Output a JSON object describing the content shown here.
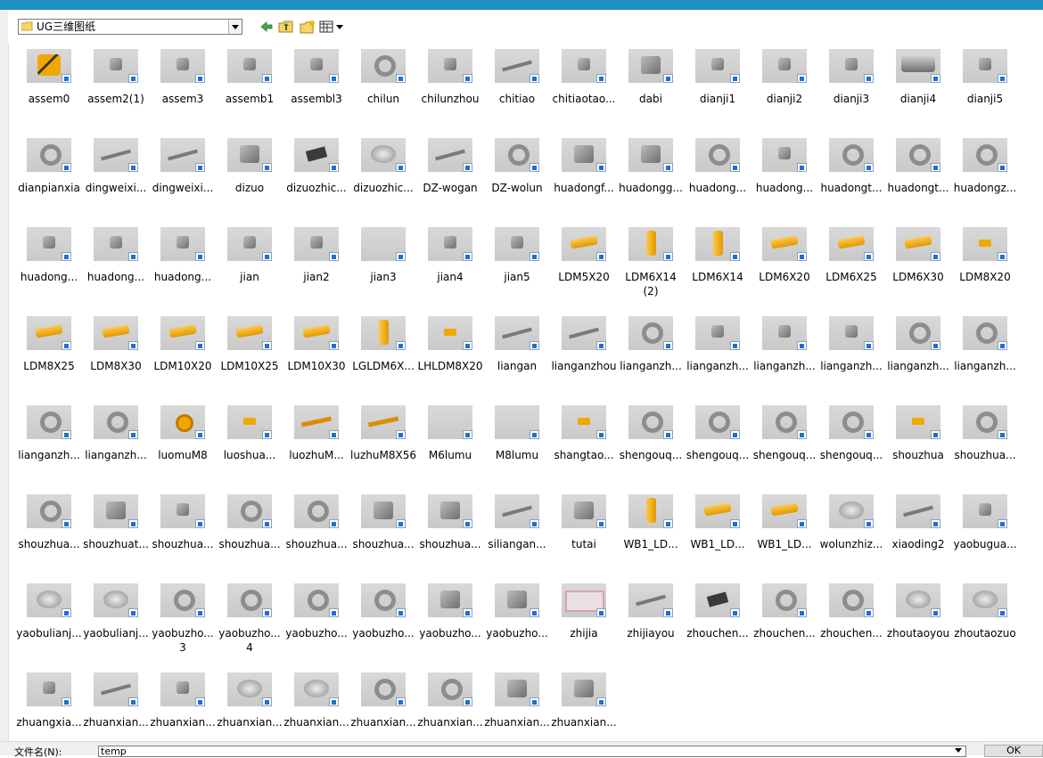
{
  "window": {
    "accent_color": "#1e8fc0"
  },
  "toolbar": {
    "path_text": "UG三维图纸",
    "buttons": [
      "back-icon",
      "up-folder-icon",
      "new-folder-icon",
      "view-menu-icon"
    ]
  },
  "files": [
    {
      "label": "assem0",
      "kind": "yellow-robot"
    },
    {
      "label": "assem2(1)",
      "kind": "gray-small"
    },
    {
      "label": "assem3",
      "kind": "gray-small"
    },
    {
      "label": "assemb1",
      "kind": "gray-small"
    },
    {
      "label": "assembl3",
      "kind": "gray-small"
    },
    {
      "label": "chilun",
      "kind": "gray-ring"
    },
    {
      "label": "chilunzhou",
      "kind": "gray-small"
    },
    {
      "label": "chitiao",
      "kind": "gray-rod"
    },
    {
      "label": "chitiaotao...",
      "kind": "gray-small"
    },
    {
      "label": "dabi",
      "kind": "gray-block"
    },
    {
      "label": "dianji1",
      "kind": "gray-small"
    },
    {
      "label": "dianji2",
      "kind": "gray-small"
    },
    {
      "label": "dianji3",
      "kind": "gray-small"
    },
    {
      "label": "dianji4",
      "kind": "gray-motor"
    },
    {
      "label": "dianji5",
      "kind": "gray-small"
    },
    {
      "label": "dianpianxia",
      "kind": "gray-ring"
    },
    {
      "label": "dingweixi...",
      "kind": "gray-rod"
    },
    {
      "label": "dingweixi...",
      "kind": "gray-rod"
    },
    {
      "label": "dizuo",
      "kind": "gray-block"
    },
    {
      "label": "dizuozhic...",
      "kind": "dark-plate"
    },
    {
      "label": "dizuozhic...",
      "kind": "gray-disc"
    },
    {
      "label": "DZ-wogan",
      "kind": "gray-rod"
    },
    {
      "label": "DZ-wolun",
      "kind": "gray-ring"
    },
    {
      "label": "huadongf...",
      "kind": "gray-block"
    },
    {
      "label": "huadongg...",
      "kind": "gray-block"
    },
    {
      "label": "huadong...",
      "kind": "gray-ring"
    },
    {
      "label": "huadong...",
      "kind": "gray-small"
    },
    {
      "label": "huadongt...",
      "kind": "gray-ring"
    },
    {
      "label": "huadongt...",
      "kind": "gray-ring"
    },
    {
      "label": "huadongz...",
      "kind": "gray-ring"
    },
    {
      "label": "huadong...",
      "kind": "gray-small"
    },
    {
      "label": "huadong...",
      "kind": "gray-small"
    },
    {
      "label": "huadong...",
      "kind": "gray-small"
    },
    {
      "label": "jian",
      "kind": "gray-small"
    },
    {
      "label": "jian2",
      "kind": "gray-small"
    },
    {
      "label": "jian3",
      "kind": "empty"
    },
    {
      "label": "jian4",
      "kind": "gray-small"
    },
    {
      "label": "jian5",
      "kind": "gray-small"
    },
    {
      "label": "LDM5X20",
      "kind": "yellow-bolt"
    },
    {
      "label": "LDM6X14\n(2)",
      "kind": "yellow-bolt-v"
    },
    {
      "label": "LDM6X14",
      "kind": "yellow-bolt-v"
    },
    {
      "label": "LDM6X20",
      "kind": "yellow-bolt"
    },
    {
      "label": "LDM6X25",
      "kind": "yellow-bolt"
    },
    {
      "label": "LDM6X30",
      "kind": "yellow-bolt"
    },
    {
      "label": "LDM8X20",
      "kind": "yellow-small"
    },
    {
      "label": "LDM8X25",
      "kind": "yellow-bolt"
    },
    {
      "label": "LDM8X30",
      "kind": "yellow-bolt"
    },
    {
      "label": "LDM10X20",
      "kind": "yellow-bolt"
    },
    {
      "label": "LDM10X25",
      "kind": "yellow-bolt"
    },
    {
      "label": "LDM10X30",
      "kind": "yellow-bolt"
    },
    {
      "label": "LGLDM6X...",
      "kind": "yellow-bolt-v"
    },
    {
      "label": "LHLDM8X20",
      "kind": "yellow-small"
    },
    {
      "label": "liangan",
      "kind": "gray-rod"
    },
    {
      "label": "lianganzhou",
      "kind": "gray-rod"
    },
    {
      "label": "lianganzh...",
      "kind": "gray-ring"
    },
    {
      "label": "lianganzh...",
      "kind": "gray-small"
    },
    {
      "label": "lianganzh...",
      "kind": "gray-small"
    },
    {
      "label": "lianganzh...",
      "kind": "gray-small"
    },
    {
      "label": "lianganzh...",
      "kind": "gray-ring"
    },
    {
      "label": "lianganzh...",
      "kind": "gray-ring"
    },
    {
      "label": "lianganzh...",
      "kind": "gray-ring"
    },
    {
      "label": "lianganzh...",
      "kind": "gray-ring"
    },
    {
      "label": "luomuM8",
      "kind": "yellow-nut"
    },
    {
      "label": "luoshua...",
      "kind": "yellow-small"
    },
    {
      "label": "luozhuM...",
      "kind": "yellow-rod"
    },
    {
      "label": "luzhuM8X56",
      "kind": "yellow-rod"
    },
    {
      "label": "M6lumu",
      "kind": "empty"
    },
    {
      "label": "M8lumu",
      "kind": "empty"
    },
    {
      "label": "shangtao...",
      "kind": "yellow-small"
    },
    {
      "label": "shengouq...",
      "kind": "gray-ring"
    },
    {
      "label": "shengouq...",
      "kind": "gray-ring"
    },
    {
      "label": "shengouq...",
      "kind": "gray-ring"
    },
    {
      "label": "shengouq...",
      "kind": "gray-ring"
    },
    {
      "label": "shouzhua",
      "kind": "yellow-small"
    },
    {
      "label": "shouzhua...",
      "kind": "gray-ring"
    },
    {
      "label": "shouzhua...",
      "kind": "gray-ring"
    },
    {
      "label": "shouzhuat...",
      "kind": "gray-block"
    },
    {
      "label": "shouzhua...",
      "kind": "gray-small"
    },
    {
      "label": "shouzhua...",
      "kind": "gray-ring"
    },
    {
      "label": "shouzhua...",
      "kind": "gray-ring"
    },
    {
      "label": "shouzhua...",
      "kind": "gray-block"
    },
    {
      "label": "shouzhua...",
      "kind": "gray-block"
    },
    {
      "label": "siliangan...",
      "kind": "gray-rod"
    },
    {
      "label": "tutai",
      "kind": "gray-block"
    },
    {
      "label": "WB1_LD...",
      "kind": "yellow-bolt-v"
    },
    {
      "label": "WB1_LD...",
      "kind": "yellow-bolt"
    },
    {
      "label": "WB1_LD...",
      "kind": "yellow-bolt"
    },
    {
      "label": "wolunzhiz...",
      "kind": "gray-disc"
    },
    {
      "label": "xiaoding2",
      "kind": "gray-rod"
    },
    {
      "label": "yaobugua...",
      "kind": "gray-small"
    },
    {
      "label": "yaobulianj...",
      "kind": "gray-disc"
    },
    {
      "label": "yaobulianj...",
      "kind": "gray-disc"
    },
    {
      "label": "yaobuzho...\n3",
      "kind": "gray-ring"
    },
    {
      "label": "yaobuzho...\n4",
      "kind": "gray-ring"
    },
    {
      "label": "yaobuzho...",
      "kind": "gray-ring"
    },
    {
      "label": "yaobuzho...",
      "kind": "gray-ring"
    },
    {
      "label": "yaobuzho...",
      "kind": "gray-block"
    },
    {
      "label": "yaobuzho...",
      "kind": "gray-block"
    },
    {
      "label": "zhijia",
      "kind": "pink-frame"
    },
    {
      "label": "zhijiayou",
      "kind": "gray-rod"
    },
    {
      "label": "zhouchen...",
      "kind": "dark-plate"
    },
    {
      "label": "zhouchen...",
      "kind": "gray-ring"
    },
    {
      "label": "zhouchen...",
      "kind": "gray-ring"
    },
    {
      "label": "zhoutaoyou",
      "kind": "gray-disc"
    },
    {
      "label": "zhoutaozuo",
      "kind": "gray-disc"
    },
    {
      "label": "zhuangxia...",
      "kind": "gray-small"
    },
    {
      "label": "zhuanxian...",
      "kind": "gray-rod"
    },
    {
      "label": "zhuanxian...",
      "kind": "gray-small"
    },
    {
      "label": "zhuanxian...",
      "kind": "gray-disc"
    },
    {
      "label": "zhuanxian...",
      "kind": "gray-disc"
    },
    {
      "label": "zhuanxian...",
      "kind": "gray-ring"
    },
    {
      "label": "zhuanxian...",
      "kind": "gray-ring"
    },
    {
      "label": "zhuanxian...",
      "kind": "gray-block"
    },
    {
      "label": "zhuanxian...",
      "kind": "gray-block"
    }
  ],
  "footer": {
    "filename_label": "文件名(N):",
    "filename_value": "temp",
    "ok_label": "OK"
  }
}
